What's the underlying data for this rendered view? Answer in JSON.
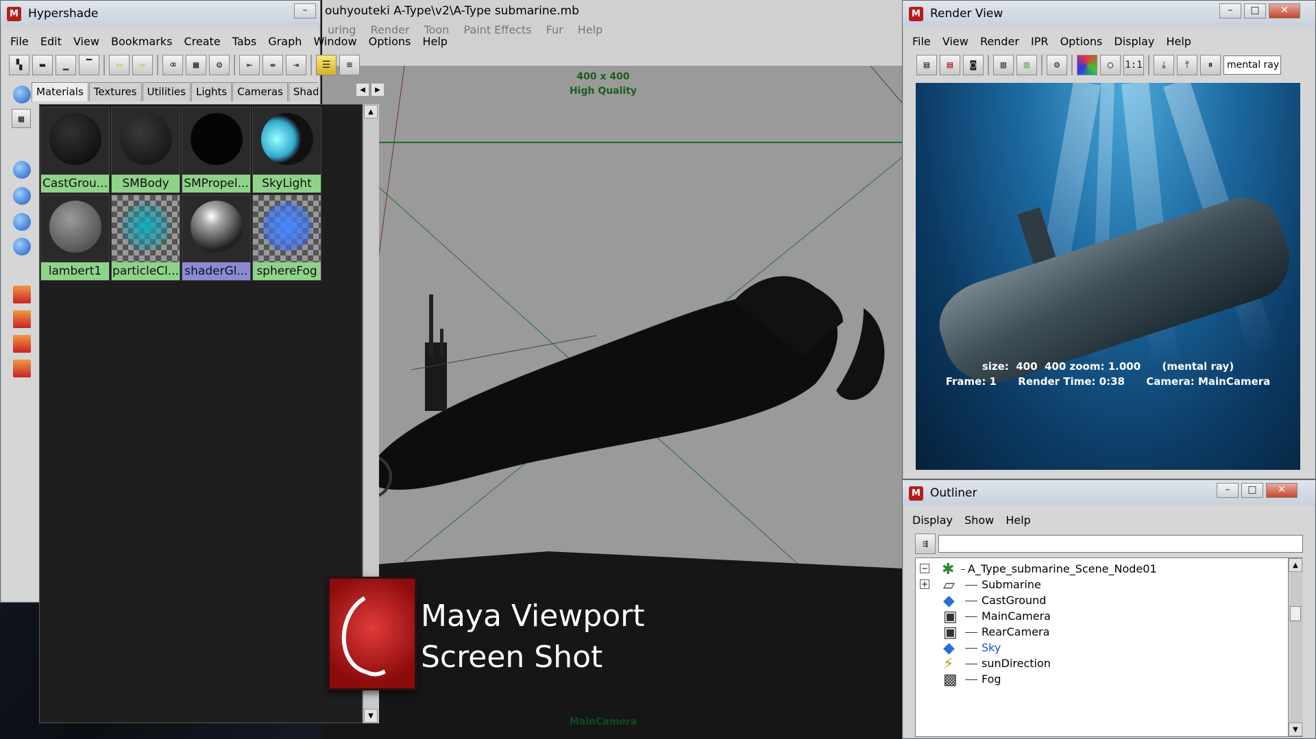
{
  "hypershade": {
    "title": "Hypershade",
    "menu": [
      "File",
      "Edit",
      "View",
      "Bookmarks",
      "Create",
      "Tabs",
      "Graph",
      "Window",
      "Options",
      "Help"
    ],
    "tabs": [
      "Materials",
      "Textures",
      "Utilities",
      "Lights",
      "Cameras",
      "Shading Groups"
    ],
    "swatches": [
      {
        "label": "CastGrou...",
        "style": "dark"
      },
      {
        "label": "SMBody",
        "style": "dark-rough"
      },
      {
        "label": "SMPropel...",
        "style": "black"
      },
      {
        "label": "SkyLight",
        "style": "crescent"
      },
      {
        "label": "lambert1",
        "style": "grey"
      },
      {
        "label": "particleCl...",
        "style": "checker-cyan"
      },
      {
        "label": "shaderGl...",
        "style": "chrome",
        "selected": true
      },
      {
        "label": "sphereFog",
        "style": "checker-blue"
      }
    ]
  },
  "viewport": {
    "file_path": "ouhyouteki A-Type\\v2\\A-Type submarine.mb",
    "menu": [
      "uring",
      "Render",
      "Toon",
      "Paint Effects",
      "Fur",
      "Help"
    ],
    "resolution": "400 x 400",
    "quality": "High Quality",
    "camera": "MainCamera"
  },
  "render_view": {
    "title": "Render View",
    "menu": [
      "File",
      "View",
      "Render",
      "IPR",
      "Options",
      "Display",
      "Help"
    ],
    "renderer_field": "mental ray",
    "info_line1": "size:  400  400 zoom: 1.000      (mental ray)",
    "info_line2": "Frame: 1      Render Time: 0:38      Camera: MainCamera"
  },
  "outliner": {
    "title": "Outliner",
    "menu": [
      "Display",
      "Show",
      "Help"
    ],
    "items": [
      {
        "label": "A_Type_submarine_Scene_Node01",
        "icon": "scene-node-icon",
        "depth": 0,
        "expander": "minus"
      },
      {
        "label": "Submarine",
        "icon": "transform-icon",
        "depth": 1,
        "expander": "plus"
      },
      {
        "label": "CastGround",
        "icon": "plane-icon",
        "depth": 1
      },
      {
        "label": "MainCamera",
        "icon": "camera-icon",
        "depth": 1
      },
      {
        "label": "RearCamera",
        "icon": "camera-icon",
        "depth": 1
      },
      {
        "label": "Sky",
        "icon": "plane-icon",
        "depth": 1,
        "highlight": true
      },
      {
        "label": "sunDirection",
        "icon": "light-icon",
        "depth": 1
      },
      {
        "label": "Fog",
        "icon": "fog-icon",
        "depth": 1
      }
    ]
  },
  "overlay": {
    "line1": "Maya Viewport",
    "line2": "Screen Shot"
  },
  "colors": {
    "swatch_label_bg": "#8fd38a",
    "swatch_selected_bg": "#8c8ad6",
    "hud_text": "#1b5e1b",
    "outliner_highlight": "#2050d0"
  }
}
